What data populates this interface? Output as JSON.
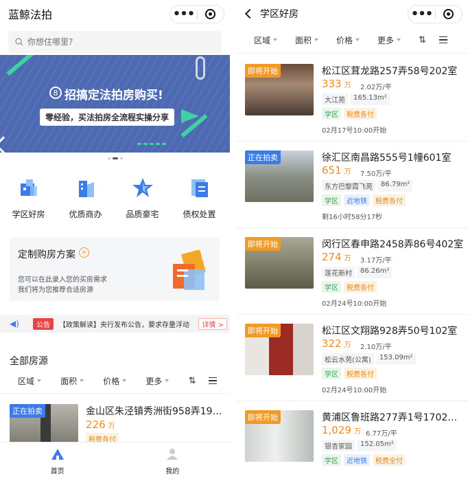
{
  "left": {
    "app_title": "蓝鲸法拍",
    "search_placeholder": "你想住哪里?",
    "banner": {
      "title": "招搞定法拍房购买!",
      "subtitle": "零经验，买法拍房全流程实操分享"
    },
    "categories": [
      {
        "label": "学区好房",
        "icon": "school-house-icon"
      },
      {
        "label": "优质商办",
        "icon": "office-building-icon"
      },
      {
        "label": "品质豪宅",
        "icon": "star-mansion-icon"
      },
      {
        "label": "债权处置",
        "icon": "claim-document-icon"
      }
    ],
    "custom_plan": {
      "title": "定制购房方案",
      "desc1": "您可以在此录入您的买房需求",
      "desc2": "我们将为您推荐合适房源"
    },
    "notice": {
      "tag": "公告",
      "text": "【政策解读】央行发布公告，要求存量浮动",
      "more": "详情 >"
    },
    "section_title": "全部房源",
    "filters": [
      "区域",
      "面积",
      "价格",
      "更多"
    ],
    "listing": {
      "badge": "正在拍卖",
      "title": "金山区朱泾镇秀洲街958弄19…",
      "price": "226",
      "price_unit": "万",
      "tag": "税费各付"
    },
    "tabs": [
      {
        "label": "首页",
        "icon": "home-icon"
      },
      {
        "label": "我的",
        "icon": "profile-icon"
      }
    ],
    "colors": {
      "accent": "#3b7ce6",
      "price": "#f08a1a",
      "banner": "#4d69b1"
    }
  },
  "right": {
    "page_title": "学区好房",
    "filters": [
      "区域",
      "面积",
      "价格",
      "更多"
    ],
    "items": [
      {
        "badge": "即将开始",
        "badge_type": "orange",
        "title": "松江区茸龙路257弄58号202室",
        "price": "333",
        "price_unit": "万",
        "unit_price": "2.02万/平",
        "meta": [
          "大江苑",
          "165.13m²"
        ],
        "tags": [
          {
            "t": "学区",
            "c": "green"
          },
          {
            "t": "税费各付",
            "c": "orange"
          }
        ],
        "time": "02月17号10:00开始"
      },
      {
        "badge": "正在拍卖",
        "badge_type": "blue",
        "title": "徐汇区南昌路555号1幢601室",
        "price": "651",
        "price_unit": "万",
        "unit_price": "7.50万/平",
        "meta": [
          "东方巴黎霞飞苑",
          "86.79m²"
        ],
        "tags": [
          {
            "t": "学区",
            "c": "green"
          },
          {
            "t": "近地铁",
            "c": "blue"
          },
          {
            "t": "税费各付",
            "c": "orange"
          }
        ],
        "time": "剩16小时58分17秒"
      },
      {
        "badge": "即将开始",
        "badge_type": "orange",
        "title": "闵行区春申路2458弄86号402室",
        "price": "274",
        "price_unit": "万",
        "unit_price": "3.17万/平",
        "meta": [
          "莲花新村",
          "86.26m²"
        ],
        "tags": [
          {
            "t": "学区",
            "c": "green"
          },
          {
            "t": "税费各付",
            "c": "orange"
          }
        ],
        "time": "02月24号10:00开始"
      },
      {
        "badge": "即将开始",
        "badge_type": "orange",
        "title": "松江区文翔路928弄50号102室",
        "price": "322",
        "price_unit": "万",
        "unit_price": "2.10万/平",
        "meta": [
          "松云水苑(公寓)",
          "153.09m²"
        ],
        "tags": [
          {
            "t": "学区",
            "c": "green"
          },
          {
            "t": "税费各付",
            "c": "orange"
          }
        ],
        "time": "02月24号10:00开始"
      },
      {
        "badge": "即将开始",
        "badge_type": "orange",
        "title": "黄浦区鲁班路277弄1号1702…",
        "price": "1,029",
        "price_unit": "万",
        "unit_price": "6.77万/平",
        "meta": [
          "银杏家园",
          "152.05m²"
        ],
        "tags": [
          {
            "t": "学区",
            "c": "green"
          },
          {
            "t": "近地铁",
            "c": "blue"
          },
          {
            "t": "税费全付",
            "c": "orange"
          }
        ],
        "time": ""
      }
    ]
  }
}
